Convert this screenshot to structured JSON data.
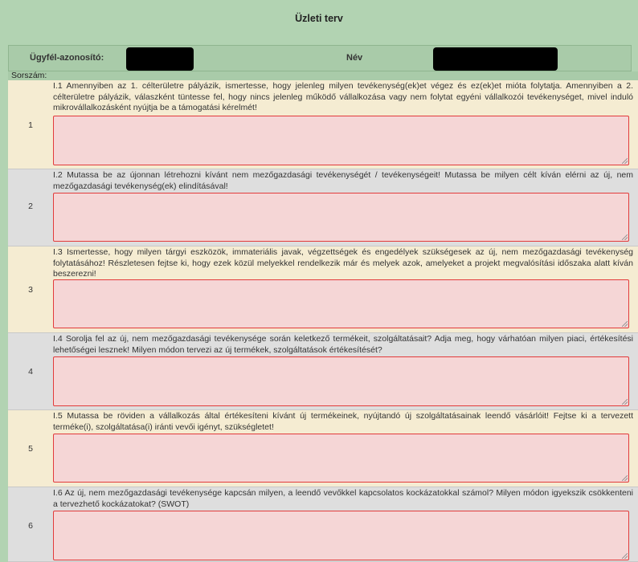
{
  "page": {
    "title": "Üzleti terv"
  },
  "header": {
    "client_id_label": "Ügyfél-azonosító:",
    "name_label": "Név"
  },
  "table": {
    "number_header": "Sorszám:",
    "questions": [
      {
        "number": "1",
        "text": "I.1 Amennyiben az 1. célterületre pályázik, ismertesse, hogy jelenleg milyen tevékenység(ek)et végez és ez(ek)et mióta folytatja. Amennyiben a 2. célterületre pályázik, válaszként tüntesse fel, hogy nincs jelenleg működő vállalkozása vagy nem folytat egyéni vállalkozói tevékenységet, mivel induló mikrovállalkozásként nyújtja be a támogatási kérelmét!",
        "answer": ""
      },
      {
        "number": "2",
        "text": "I.2 Mutassa be az újonnan létrehozni kívánt nem mezőgazdasági tevékenységét / tevékenységeit! Mutassa be milyen célt kíván elérni az új, nem mezőgazdasági tevékenység(ek) elindításával!",
        "answer": ""
      },
      {
        "number": "3",
        "text": "I.3 Ismertesse, hogy milyen tárgyi eszközök, immateriális javak, végzettségek és engedélyek szükségesek az új, nem mezőgazdasági tevékenység folytatásához! Részletesen fejtse ki, hogy ezek közül melyekkel rendelkezik már és melyek azok, amelyeket a projekt megvalósítási időszaka alatt kíván beszerezni!",
        "answer": ""
      },
      {
        "number": "4",
        "text": "I.4 Sorolja fel az új, nem mezőgazdasági tevékenysége során keletkező termékeit, szolgáltatásait? Adja meg, hogy várhatóan milyen piaci, értékesítési lehetőségei lesznek! Milyen módon tervezi az új termékek, szolgáltatások értékesítését?",
        "answer": ""
      },
      {
        "number": "5",
        "text": "I.5 Mutassa be röviden a vállalkozás által értékesíteni kívánt új termékeinek, nyújtandó új szolgáltatásainak leendő vásárlóit! Fejtse ki a tervezett terméke(i), szolgáltatása(i) iránti vevői igényt, szükségletet!",
        "answer": ""
      },
      {
        "number": "6",
        "text": "I.6 Az új, nem mezőgazdasági tevékenysége kapcsán milyen, a leendő vevőkkel kapcsolatos kockázatokkal számol? Milyen módon igyekszik csökkenteni a tervezhető kockázatokat? (SWOT)",
        "answer": ""
      }
    ]
  }
}
